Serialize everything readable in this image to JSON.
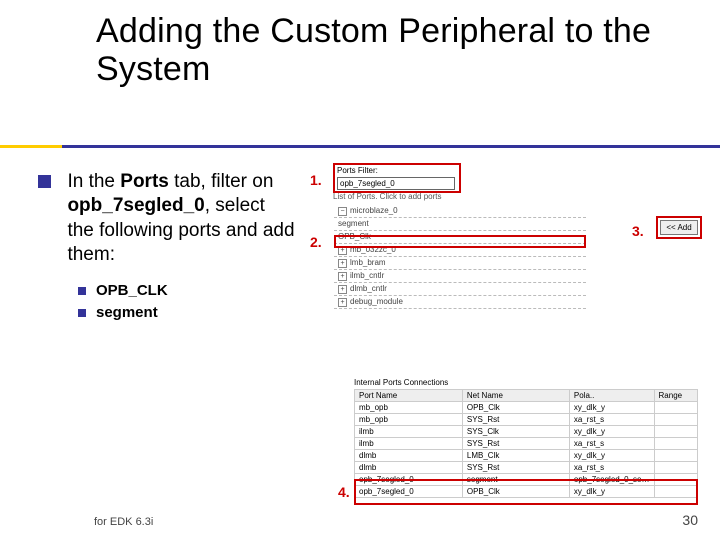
{
  "title": "Adding the Custom Peripheral to the System",
  "lead": {
    "pre": "In the ",
    "b1": "Ports",
    "mid1": " tab, filter on ",
    "b2": "opb_7segled_0",
    "post": ", select the following ports and add them:"
  },
  "sub": {
    "a": "OPB_CLK",
    "b": "segment"
  },
  "num": {
    "n1": "1.",
    "n2": "2.",
    "n3": "3.",
    "n4": "4."
  },
  "shot1": {
    "label": "Ports Filter:",
    "input": "opb_7segled_0",
    "listHeader": "List of Ports. Click to add ports",
    "items": [
      "microblaze_0",
      "segment",
      "OPB_Clk",
      "mb_032zc_0",
      "lmb_bram",
      "ilmb_cntlr",
      "dlmb_cntlr",
      "debug_module"
    ],
    "addBtn": "<< Add"
  },
  "shot2": {
    "hdr": "Internal Ports Connections",
    "cols": {
      "port": "Port Name",
      "net": "Net Name",
      "pol": "Pola..",
      "rng": "Range"
    },
    "rows": [
      {
        "port": "mb_opb",
        "net": "OPB_Clk",
        "net2": "xy_dlk_y"
      },
      {
        "port": "mb_opb",
        "net": "SYS_Rst",
        "net2": "xa_rst_s"
      },
      {
        "port": "ilmb",
        "net": "SYS_Clk",
        "net2": "xy_dlk_y"
      },
      {
        "port": "ilmb",
        "net": "SYS_Rst",
        "net2": "xa_rst_s"
      },
      {
        "port": "dlmb",
        "net": "LMB_Clk",
        "net2": "xy_dlk_y"
      },
      {
        "port": "dlmb",
        "net": "SYS_Rst",
        "net2": "xa_rst_s"
      },
      {
        "port": "opb_7segled_0",
        "net": "segment",
        "net2": "opb_7segled_0_se…"
      },
      {
        "port": "opb_7segled_0",
        "net": "OPB_Clk",
        "net2": "xy_dlk_y"
      }
    ]
  },
  "footer": {
    "left": "for EDK 6.3i",
    "right": "30"
  }
}
